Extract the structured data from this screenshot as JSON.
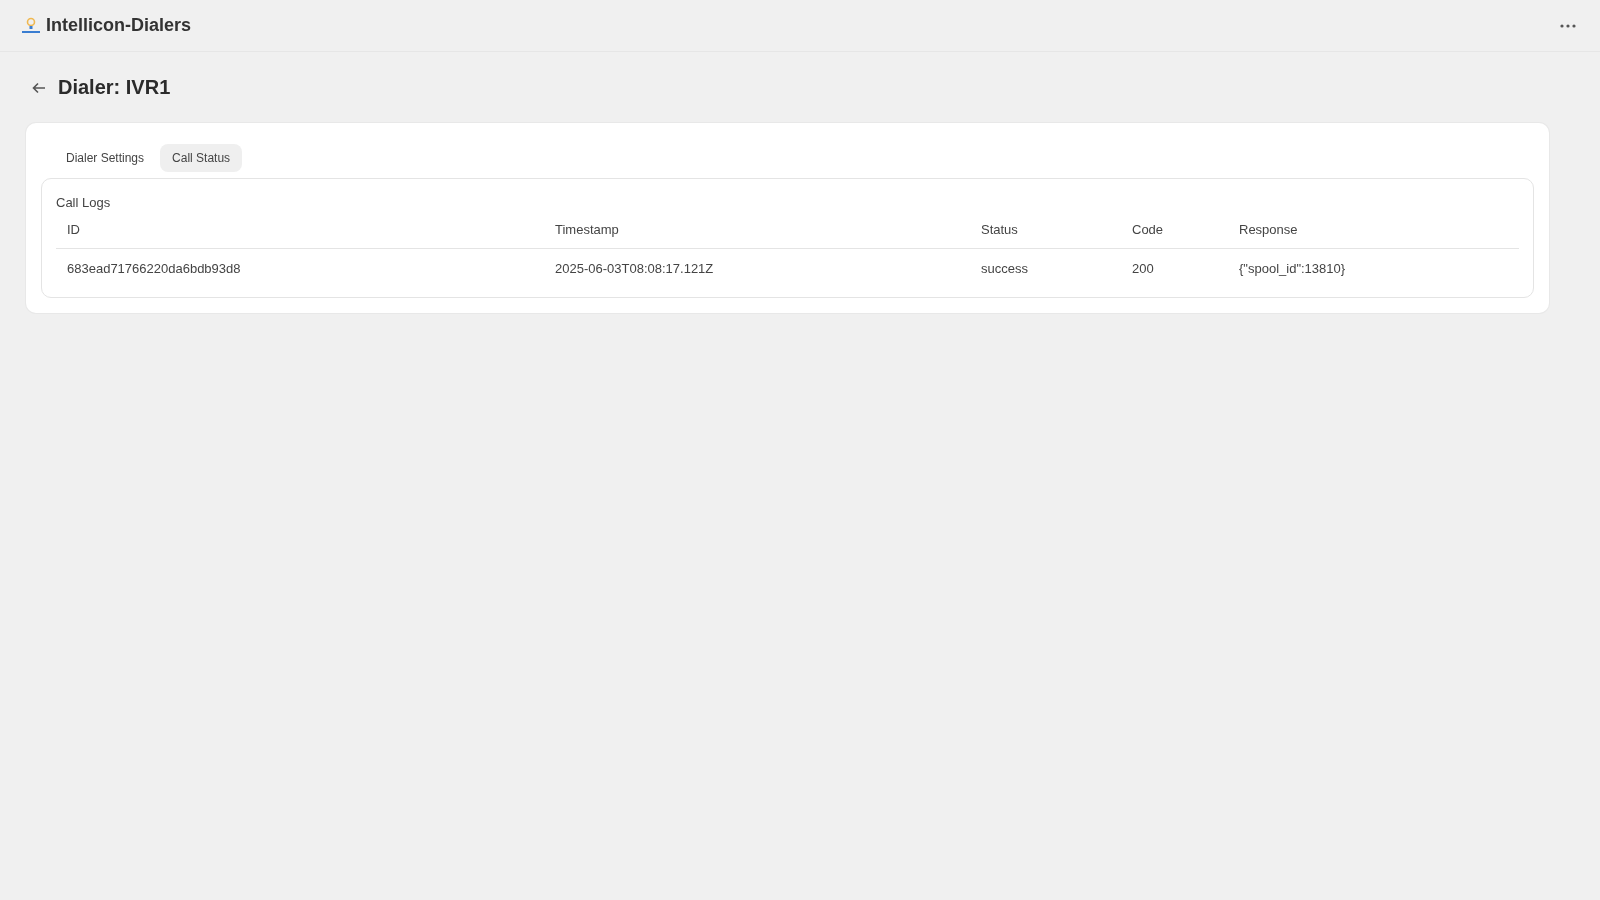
{
  "app": {
    "title": "Intellicon-Dialers"
  },
  "page": {
    "title": "Dialer: IVR1"
  },
  "tabs": [
    {
      "label": "Dialer Settings",
      "selected": false
    },
    {
      "label": "Call Status",
      "selected": true
    }
  ],
  "call_logs": {
    "title": "Call Logs",
    "columns": [
      "ID",
      "Timestamp",
      "Status",
      "Code",
      "Response"
    ],
    "rows": [
      [
        "683ead71766220da6bdb93d8",
        "2025-06-03T08:08:17.121Z",
        "success",
        "200",
        "{\"spool_id\":13810}"
      ]
    ]
  }
}
